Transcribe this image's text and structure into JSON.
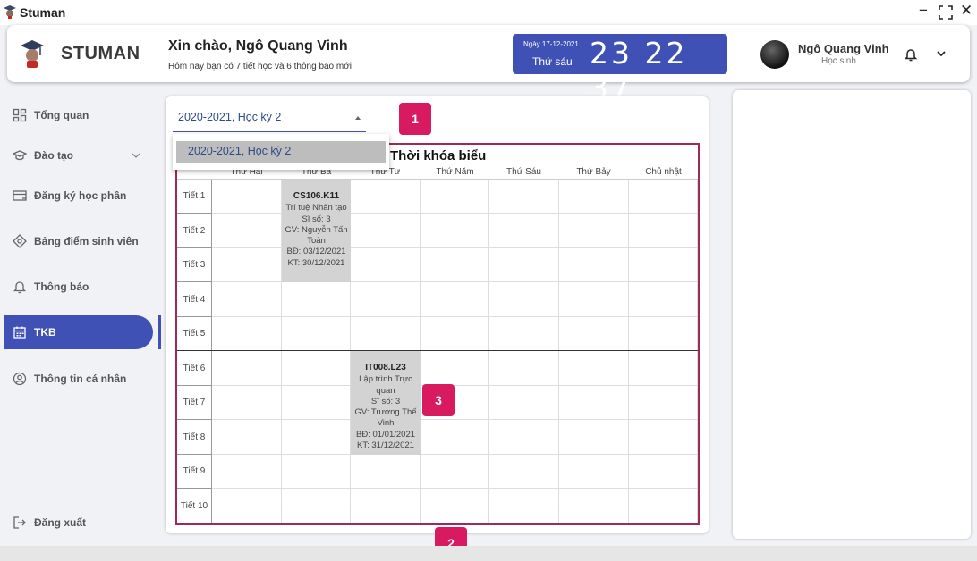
{
  "window": {
    "title": "Stuman",
    "minimize": "−",
    "maximize": "⛶",
    "close": "✕"
  },
  "header": {
    "brand": "STUMAN",
    "greeting": "Xin chào, Ngô Quang Vinh",
    "subtitle": "Hôm nay bạn có 7 tiết học và 6 thông báo mới",
    "clock": {
      "date": "Ngày 17-12-2021",
      "day": "Thứ sáu",
      "time": "23 22 37"
    },
    "user": {
      "name": "Ngô Quang Vinh",
      "role": "Học sinh"
    }
  },
  "sidebar": {
    "items": [
      {
        "label": "Tổng quan",
        "icon": "dashboard-icon"
      },
      {
        "label": "Đào tạo",
        "icon": "graduation-cap-icon"
      },
      {
        "label": "Đăng ký học phần",
        "icon": "add-list-icon"
      },
      {
        "label": "Bảng điểm sinh viên",
        "icon": "diamond-icon"
      },
      {
        "label": "Thông báo",
        "icon": "bell-icon"
      },
      {
        "label": "TKB",
        "icon": "calendar-icon"
      },
      {
        "label": "Thông tin cá nhân",
        "icon": "user-icon"
      }
    ],
    "logout": "Đăng xuất",
    "active": "TKB"
  },
  "semester": {
    "selected": "2020-2021, Học kỳ 2",
    "options": [
      "2020-2021, Học kỳ 2"
    ]
  },
  "timetable": {
    "title": "Thời khóa biểu",
    "days": [
      "Thứ Hai",
      "Thứ Ba",
      "Thứ Tư",
      "Thứ Năm",
      "Thứ Sáu",
      "Thứ Bảy",
      "Chủ nhật"
    ],
    "periods": [
      "Tiết 1",
      "Tiết 2",
      "Tiết 3",
      "Tiết 4",
      "Tiết 5",
      "Tiết 6",
      "Tiết 7",
      "Tiết 8",
      "Tiết 9",
      "Tiết 10"
    ],
    "courses": [
      {
        "code": "CS106.K11",
        "name": "Trí tuệ Nhân tạo",
        "size": "Sĩ số: 3",
        "teacher": "GV: Nguyễn Tấn Toàn",
        "start": "BĐ: 03/12/2021",
        "end": "KT: 30/12/2021"
      },
      {
        "code": "IT008.L23",
        "name": "Lập trình Trực quan",
        "size": "Sĩ số: 3",
        "teacher": "GV: Trương Thế Vinh",
        "start": "BĐ: 01/01/2021",
        "end": "KT: 31/12/2021"
      }
    ]
  },
  "annotations": [
    "1",
    "2",
    "3"
  ]
}
